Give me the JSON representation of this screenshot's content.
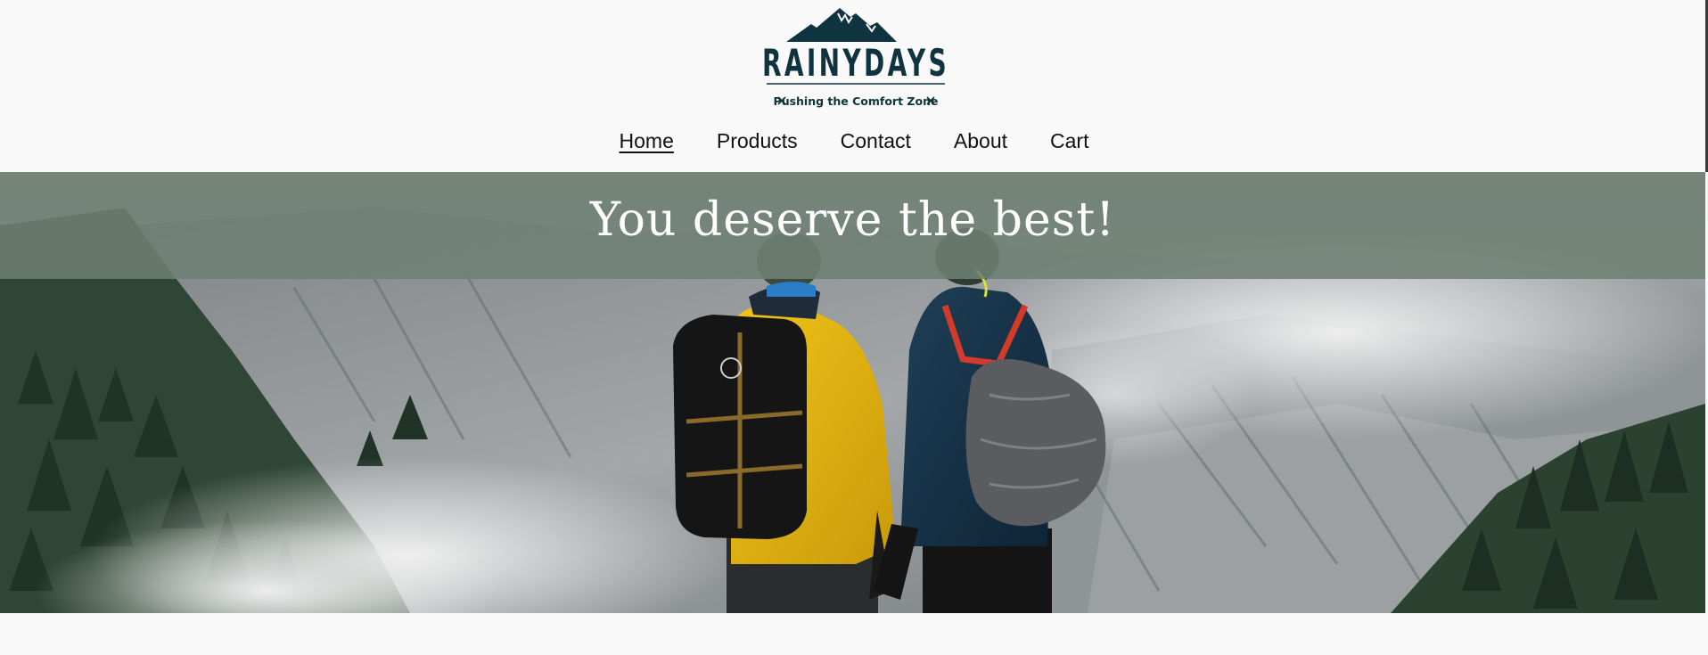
{
  "brand": {
    "name": "RAINYDAYS",
    "tagline": "Pushing the Comfort Zone",
    "colors": {
      "primary": "#0f3440",
      "background": "#f9f9f9",
      "banner": "#6e8074"
    }
  },
  "nav": {
    "items": [
      {
        "label": "Home",
        "active": true
      },
      {
        "label": "Products",
        "active": false
      },
      {
        "label": "Contact",
        "active": false
      },
      {
        "label": "About",
        "active": false
      },
      {
        "label": "Cart",
        "active": false
      }
    ]
  },
  "hero": {
    "title": "You deserve the best!"
  }
}
